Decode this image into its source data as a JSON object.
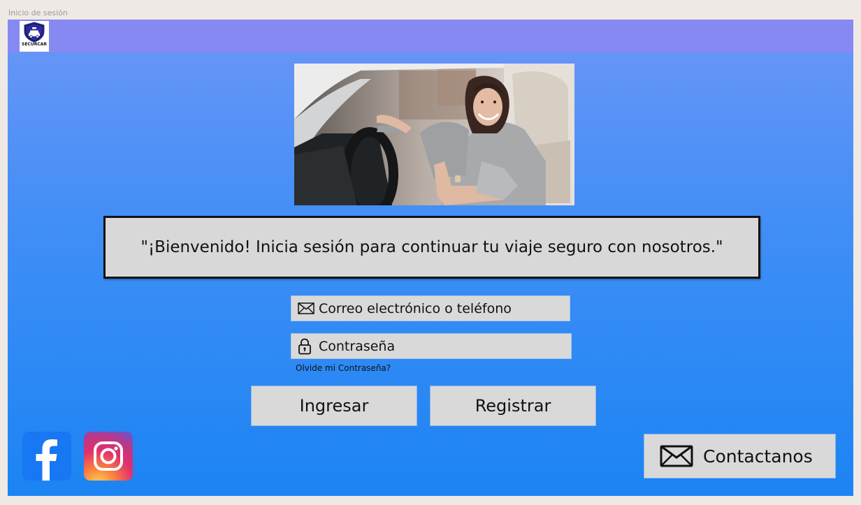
{
  "frame": {
    "title": "Inicio de sesión"
  },
  "brand": {
    "logo_text": "SECURCAR",
    "logo_icon": "car-shield-icon"
  },
  "hero": {
    "image": "woman-driver-thumbs-up-photo"
  },
  "welcome": {
    "message": "\"¡Bienvenido! Inicia sesión para continuar tu viaje seguro con nosotros.\""
  },
  "form": {
    "email_label": "Correo electrónico o teléfono",
    "email_icon": "envelope-icon",
    "password_label": "Contraseña",
    "password_icon": "lock-icon",
    "forgot_label": "Olvide mi Contraseña?"
  },
  "actions": {
    "login_label": "Ingresar",
    "register_label": "Registrar"
  },
  "social": [
    {
      "name": "facebook",
      "icon": "facebook-icon"
    },
    {
      "name": "instagram",
      "icon": "instagram-icon"
    }
  ],
  "contact": {
    "label": "Contactanos",
    "icon": "envelope-icon"
  },
  "colors": {
    "topbar": "#8689f2",
    "gradient_top": "#6c96f6",
    "gradient_bottom": "#1b84f3",
    "control_fill": "#d9d9d9",
    "facebook": "#1877f2"
  }
}
